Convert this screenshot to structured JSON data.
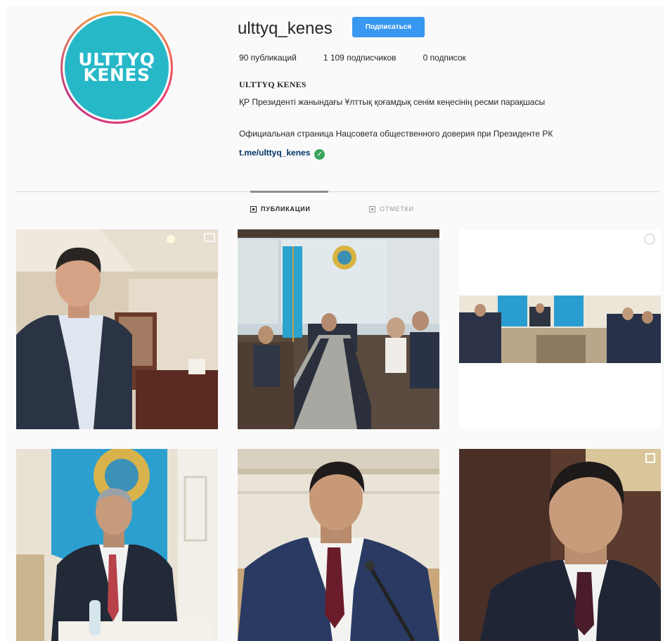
{
  "profile": {
    "username": "ulttyq_kenes",
    "follow_label": "Подписаться",
    "logo_line1": "ULTTYQ",
    "logo_line2": "KEŃES",
    "stats": {
      "posts": "90 публикаций",
      "followers": "1 109 подписчиков",
      "following": "0 подписок"
    },
    "full_name": "ULTTYQ KENES",
    "bio_line1": "ҚР Президенті жанындағы Ұлттық қоғамдық сенім кеңесінің ресми парақшасы",
    "bio_line2": "Официальная страница Нацсовета общественного доверия при Президенте РК",
    "link": "t.me/ulttyq_kenes"
  },
  "tabs": [
    {
      "label": "Публикации",
      "active": true
    },
    {
      "label": "Отметки",
      "active": false
    }
  ],
  "colors": {
    "accent": "#3897f0",
    "logo_bg": "#27b8c8",
    "verified": "#3aa35c"
  },
  "posts": [
    {
      "type": "video",
      "icon": "video-icon"
    },
    {
      "type": "photo",
      "icon": null
    },
    {
      "type": "carousel",
      "icon": "carousel-icon"
    },
    {
      "type": "photo",
      "icon": null
    },
    {
      "type": "photo",
      "icon": null
    },
    {
      "type": "carousel",
      "icon": "carousel-icon"
    }
  ]
}
